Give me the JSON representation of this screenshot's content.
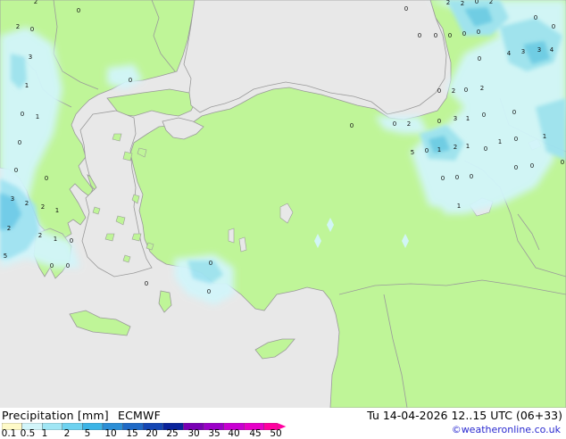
{
  "map": {
    "source": "ECMWF",
    "variable": "Precipitation [mm]",
    "valid_time": "Tu 14-04-2026 12..15 UTC (06+33)",
    "credit": "©weatheronline.co.uk",
    "colors": {
      "land": "#bff598",
      "sea": "#e8e8e8",
      "coast": "#9a9a9a",
      "precip_light": "#d2f5fa",
      "precip_moderate": "#9fe3f2",
      "precip_heavy": "#6ccbe8"
    },
    "point_values": [
      {
        "label": "2"
      },
      {
        "label": "0"
      },
      {
        "label": "2"
      },
      {
        "label": "0"
      },
      {
        "label": "3"
      },
      {
        "label": "1"
      },
      {
        "label": "0"
      },
      {
        "label": "1"
      },
      {
        "label": "0"
      },
      {
        "label": "0"
      },
      {
        "label": "0"
      },
      {
        "label": "3"
      },
      {
        "label": "2"
      },
      {
        "label": "2"
      },
      {
        "label": "1"
      },
      {
        "label": "2"
      },
      {
        "label": "2"
      },
      {
        "label": "1"
      },
      {
        "label": "0"
      },
      {
        "label": "5"
      },
      {
        "label": "0"
      },
      {
        "label": "0"
      },
      {
        "label": "0"
      },
      {
        "label": "0"
      },
      {
        "label": "0"
      },
      {
        "label": "0"
      },
      {
        "label": "2"
      },
      {
        "label": "2"
      },
      {
        "label": "0"
      },
      {
        "label": "2"
      },
      {
        "label": "0"
      },
      {
        "label": "0"
      },
      {
        "label": "0"
      },
      {
        "label": "0"
      },
      {
        "label": "0"
      },
      {
        "label": "0"
      },
      {
        "label": "0"
      },
      {
        "label": "0"
      },
      {
        "label": "4"
      },
      {
        "label": "3"
      },
      {
        "label": "3"
      },
      {
        "label": "4"
      },
      {
        "label": "0"
      },
      {
        "label": "0"
      },
      {
        "label": "2"
      },
      {
        "label": "0"
      },
      {
        "label": "2"
      },
      {
        "label": "0"
      },
      {
        "label": "0"
      },
      {
        "label": "2"
      },
      {
        "label": "0"
      },
      {
        "label": "3"
      },
      {
        "label": "1"
      },
      {
        "label": "0"
      },
      {
        "label": "0"
      },
      {
        "label": "0"
      },
      {
        "label": "1"
      },
      {
        "label": "2"
      },
      {
        "label": "1"
      },
      {
        "label": "1"
      },
      {
        "label": "0"
      },
      {
        "label": "1"
      },
      {
        "label": "5"
      },
      {
        "label": "0"
      },
      {
        "label": "0"
      },
      {
        "label": "0"
      },
      {
        "label": "0"
      },
      {
        "label": "0"
      },
      {
        "label": "0"
      },
      {
        "label": "0"
      },
      {
        "label": "1"
      }
    ]
  },
  "legend": {
    "ticks": [
      "0.1",
      "0.5",
      "1",
      "2",
      "5",
      "10",
      "15",
      "20",
      "25",
      "30",
      "35",
      "40",
      "45",
      "50"
    ],
    "colors": [
      "#fffac8",
      "#d2f5fa",
      "#a0e6f5",
      "#6ed2f0",
      "#3cb4e6",
      "#2b8ed6",
      "#1f69c6",
      "#1446b4",
      "#0a239b",
      "#7800b4",
      "#9b00c8",
      "#c800d2",
      "#e600c8",
      "#ff00a0"
    ]
  }
}
